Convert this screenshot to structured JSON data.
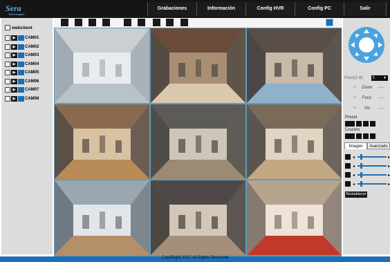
{
  "app": {
    "logo_text": "Sera",
    "logo_sub": "Technologies"
  },
  "nav": {
    "items": [
      "Grabaciones",
      "Información",
      "Config HVR",
      "Config PC",
      "Salir"
    ]
  },
  "sidebar": {
    "client_label": "webclient",
    "cameras": [
      "CAM01",
      "CAM02",
      "CAM03",
      "CAM04",
      "CAM05",
      "CAM06",
      "CAM07",
      "CAM08"
    ]
  },
  "toolbar": {
    "icons": [
      "single-view-icon",
      "quad-view-icon",
      "six-view-icon",
      "nine-view-icon",
      "sixteen-view-icon",
      "fullscreen-icon",
      "snapshot-icon",
      "record-icon",
      "playback-icon",
      "grid-active-icon"
    ]
  },
  "ptz": {
    "speed_label": "Paso(1-8):",
    "speed_value": "5",
    "zoom_label": "Zoom",
    "focus_label": "Foco",
    "iris_label": "Iris",
    "preset_label": "Preset",
    "cruise_label": "Crucero"
  },
  "image_tabs": [
    "Imagen",
    "Avanzado"
  ],
  "image_controls": [
    "brightness-icon",
    "contrast-icon",
    "saturation-icon",
    "hue-icon"
  ],
  "image_levels": [
    0.1,
    0.1,
    0.1,
    0.1
  ],
  "reset_label": "Restablecer",
  "footer": {
    "copyright": "CopyRight 2017 All Rights Reserved"
  },
  "colors": {
    "accent": "#1d6fb5",
    "topbar": "#151515",
    "panel": "#dcdcdc"
  }
}
